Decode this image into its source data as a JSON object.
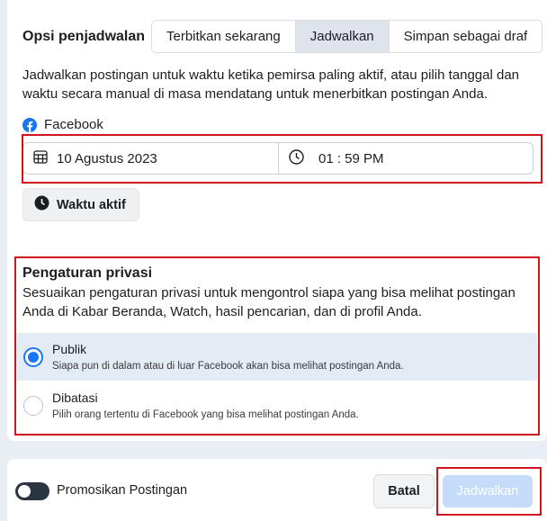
{
  "scheduling": {
    "title": "Opsi penjadwalan",
    "tabs": [
      {
        "label": "Terbitkan sekarang",
        "active": false
      },
      {
        "label": "Jadwalkan",
        "active": true
      },
      {
        "label": "Simpan sebagai draf",
        "active": false
      }
    ],
    "description": "Jadwalkan postingan untuk waktu ketika pemirsa paling aktif, atau pilih tanggal dan waktu secara manual di masa mendatang untuk menerbitkan postingan Anda.",
    "platform": "Facebook",
    "date": "10 Agustus 2023",
    "time": "01 : 59 PM",
    "active_time_button": "Waktu aktif"
  },
  "privacy": {
    "title": "Pengaturan privasi",
    "description": "Sesuaikan pengaturan privasi untuk mengontrol siapa yang bisa melihat postingan Anda di Kabar Beranda, Watch, hasil pencarian, dan di profil Anda.",
    "options": [
      {
        "label": "Publik",
        "detail": "Siapa pun di dalam atau di luar Facebook akan bisa melihat postingan Anda.",
        "selected": true
      },
      {
        "label": "Dibatasi",
        "detail": "Pilih orang tertentu di Facebook yang bisa melihat postingan Anda.",
        "selected": false
      }
    ]
  },
  "footer": {
    "promote_label": "Promosikan Postingan",
    "promote_on": false,
    "cancel_label": "Batal",
    "schedule_label": "Jadwalkan"
  },
  "colors": {
    "accent": "#1877f2",
    "highlight_box": "#d0141b",
    "disabled_button": "#c4dcfa"
  },
  "icons": [
    "facebook-logo-icon",
    "calendar-icon",
    "clock-icon"
  ]
}
